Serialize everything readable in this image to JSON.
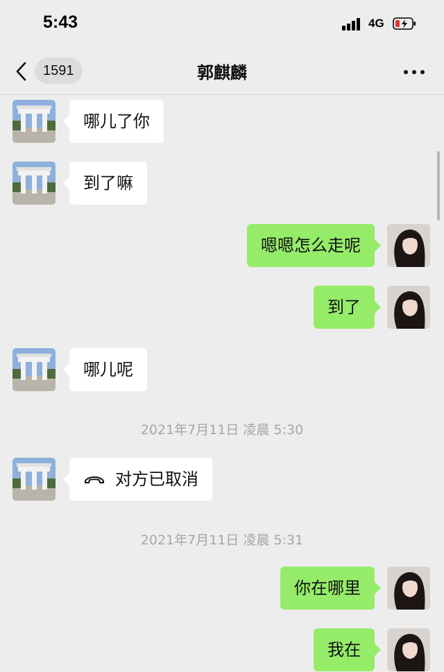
{
  "status_bar": {
    "time": "5:43",
    "network": "4G"
  },
  "header": {
    "unread_count": "1591",
    "title": "郭麒麟"
  },
  "messages": [
    {
      "side": "in",
      "text": "哪儿了你"
    },
    {
      "side": "in",
      "text": "到了嘛"
    },
    {
      "side": "out",
      "text": "嗯嗯怎么走呢"
    },
    {
      "side": "out",
      "text": "到了"
    },
    {
      "side": "in",
      "text": "哪儿呢"
    },
    {
      "type": "time",
      "text": "2021年7月11日 凌晨 5:30"
    },
    {
      "side": "in",
      "text": "对方已取消",
      "icon": "phone-hangup-icon"
    },
    {
      "type": "time",
      "text": "2021年7月11日 凌晨 5:31"
    },
    {
      "side": "out",
      "text": "你在哪里"
    },
    {
      "side": "out",
      "text": "我在"
    }
  ],
  "colors": {
    "background": "#ededed",
    "outgoing_bubble": "#95ec69",
    "incoming_bubble": "#ffffff",
    "timestamp": "#a6a6a6"
  }
}
